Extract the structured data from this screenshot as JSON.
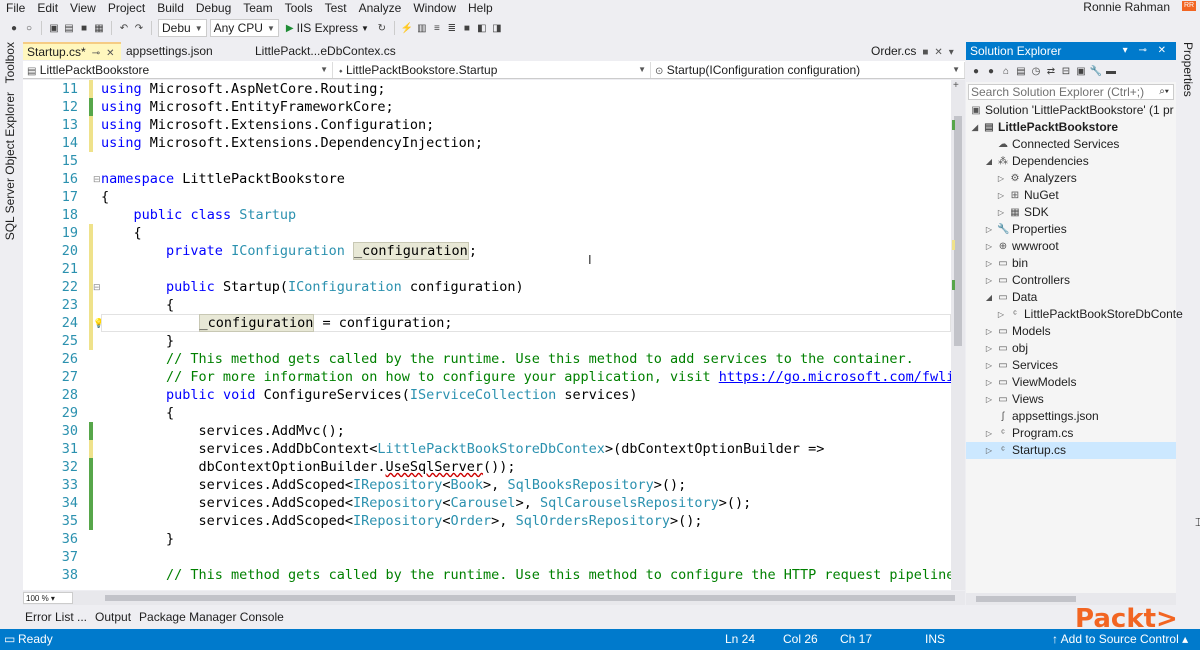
{
  "menu": [
    "File",
    "Edit",
    "View",
    "Project",
    "Build",
    "Debug",
    "Team",
    "Tools",
    "Test",
    "Analyze",
    "Window",
    "Help"
  ],
  "user": {
    "name": "Ronnie Rahman",
    "badge": "RR"
  },
  "toolbar": {
    "config": "Debu",
    "platform": "Any CPU",
    "run_target": "IIS Express"
  },
  "left_tool_tabs": [
    "Toolbox",
    "SQL Server Object Explorer"
  ],
  "right_tool_tabs": [
    "Properties"
  ],
  "editor_tabs": [
    "Startup.cs*",
    "appsettings.json",
    "LittlePackt...eDbContex.cs",
    "Order.cs"
  ],
  "navbar": {
    "project": "LittlePacktBookstore",
    "class": "LittlePacktBookstore.Startup",
    "member": "Startup(IConfiguration configuration)"
  },
  "code": {
    "line_numbers": [
      "11",
      "12",
      "13",
      "14",
      "15",
      "16",
      "17",
      "18",
      "19",
      "20",
      "21",
      "22",
      "23",
      "24",
      "25",
      "26",
      "27",
      "28",
      "29",
      "30",
      "31",
      "32",
      "33",
      "34",
      "35",
      "36",
      "37",
      "38"
    ],
    "l11": [
      "using",
      " Microsoft.AspNetCore.Routing;"
    ],
    "l12": [
      "using",
      " Microsoft.EntityFrameworkCore;"
    ],
    "l13": [
      "using",
      " Microsoft.Extensions.Configuration;"
    ],
    "l14": [
      "using",
      " Microsoft.Extensions.DependencyInjection;"
    ],
    "l16": [
      "namespace",
      " LittlePacktBookstore"
    ],
    "l17": "{",
    "l18": [
      "public",
      " ",
      "class",
      " ",
      "Startup"
    ],
    "l19": "{",
    "l20": [
      "private",
      " ",
      "IConfiguration",
      " ",
      "_configuration",
      ";"
    ],
    "l22": [
      "public",
      " Startup(",
      "IConfiguration",
      " configuration)"
    ],
    "l23": "{",
    "l24": [
      "_configuration",
      " = configuration;"
    ],
    "l25": "}",
    "l26": "// This method gets called by the runtime. Use this method to add services to the container.",
    "l27": [
      "// For more information on how to configure your application, visit ",
      "https://go.microsoft.com/fwli"
    ],
    "l28": [
      "public",
      " ",
      "void",
      " ConfigureServices(",
      "IServiceCollection",
      " services)"
    ],
    "l29": "{",
    "l30": "services.AddMvc();",
    "l31": [
      "services.AddDbContext<",
      "LittlePacktBookStoreDbContex",
      ">(dbContextOptionBuilder =>"
    ],
    "l32": [
      "dbContextOptionBuilder.",
      "UseSqlServer",
      "());"
    ],
    "l33": [
      "services.AddScoped<",
      "IRepository",
      "<",
      "Book",
      ">, ",
      "SqlBooksRepository",
      ">();"
    ],
    "l34": [
      "services.AddScoped<",
      "IRepository",
      "<",
      "Carousel",
      ">, ",
      "SqlCarouselsRepository",
      ">();"
    ],
    "l35": [
      "services.AddScoped<",
      "IRepository",
      "<",
      "Order",
      ">, ",
      "SqlOrdersRepository",
      ">();"
    ],
    "l36": "}",
    "l38": "// This method gets called by the runtime. Use this method to configure the HTTP request pipeline"
  },
  "zoom": "100 %",
  "solution_explorer": {
    "title": "Solution Explorer",
    "search_placeholder": "Search Solution Explorer (Ctrl+;)",
    "items": [
      "Solution 'LittlePacktBookstore' (1 pr",
      "LittlePacktBookstore",
      "Connected Services",
      "Dependencies",
      "Analyzers",
      "NuGet",
      "SDK",
      "Properties",
      "wwwroot",
      "bin",
      "Controllers",
      "Data",
      "LittlePacktBookStoreDbConte",
      "Models",
      "obj",
      "Services",
      "ViewModels",
      "Views",
      "appsettings.json",
      "Program.cs",
      "Startup.cs"
    ]
  },
  "bottom_tabs": [
    "Error List ...",
    "Output",
    "Package Manager Console"
  ],
  "status": {
    "ready": "Ready",
    "ln": "Ln 24",
    "col": "Col 26",
    "ch": "Ch 17",
    "mode": "INS",
    "source_control": "Add to Source Control"
  },
  "watermark": "Packt>",
  "colors": {
    "accent": "#007acc",
    "keyword": "#0000ff",
    "type": "#2b91af",
    "comment": "#008000",
    "brand": "#f26522"
  }
}
